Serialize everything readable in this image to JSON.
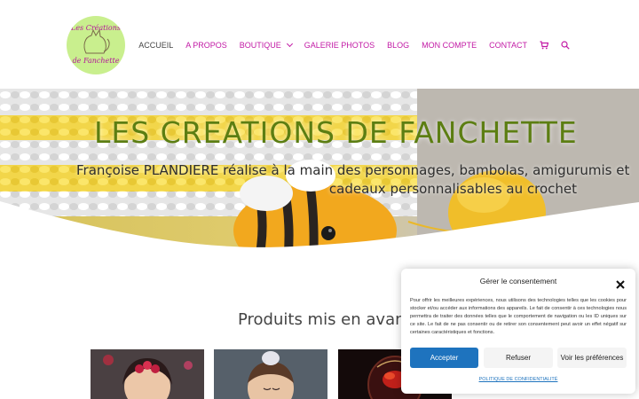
{
  "logo": {
    "line1": "Les Créations",
    "line2": "de Fanchette"
  },
  "nav": {
    "items": [
      {
        "label": "ACCUEIL",
        "active": true
      },
      {
        "label": "A PROPOS"
      },
      {
        "label": "BOUTIQUE",
        "has_dropdown": true
      },
      {
        "label": "GALERIE PHOTOS"
      },
      {
        "label": "BLOG"
      },
      {
        "label": "MON COMPTE"
      },
      {
        "label": "CONTACT"
      }
    ],
    "cart_icon": "cart-icon",
    "search_icon": "search-icon"
  },
  "hero": {
    "title": "LES CREATIONS DE FANCHETTE",
    "subtitle_line1": "Françoise PLANDIERE réalise à la main des personnages, bambolas, amigurumis et",
    "subtitle_line2": "cadeaux personnalisables au crochet"
  },
  "products": {
    "title": "Produits mis en avant"
  },
  "consent": {
    "title": "Gérer le consentement",
    "text": "Pour offrir les meilleures expériences, nous utilisons des technologies telles que les cookies pour stocker et/ou accéder aux informations des appareils. Le fait de consentir à ces technologies nous permettra de traiter des données telles que le comportement de navigation ou les ID uniques sur ce site. Le fait de ne pas consentir ou de retirer son consentement peut avoir un effet négatif sur certaines caractéristiques et fonctions.",
    "accept_label": "Accepter",
    "refuse_label": "Refuser",
    "prefs_label": "Voir les préférences",
    "policy_link": "POLITIQUE DE CONFIDENTIALITÉ"
  },
  "colors": {
    "accent": "#c21aa5",
    "title_green": "#5c7e12",
    "button_blue": "#1e73be",
    "logo_green": "#c9ef8e"
  }
}
